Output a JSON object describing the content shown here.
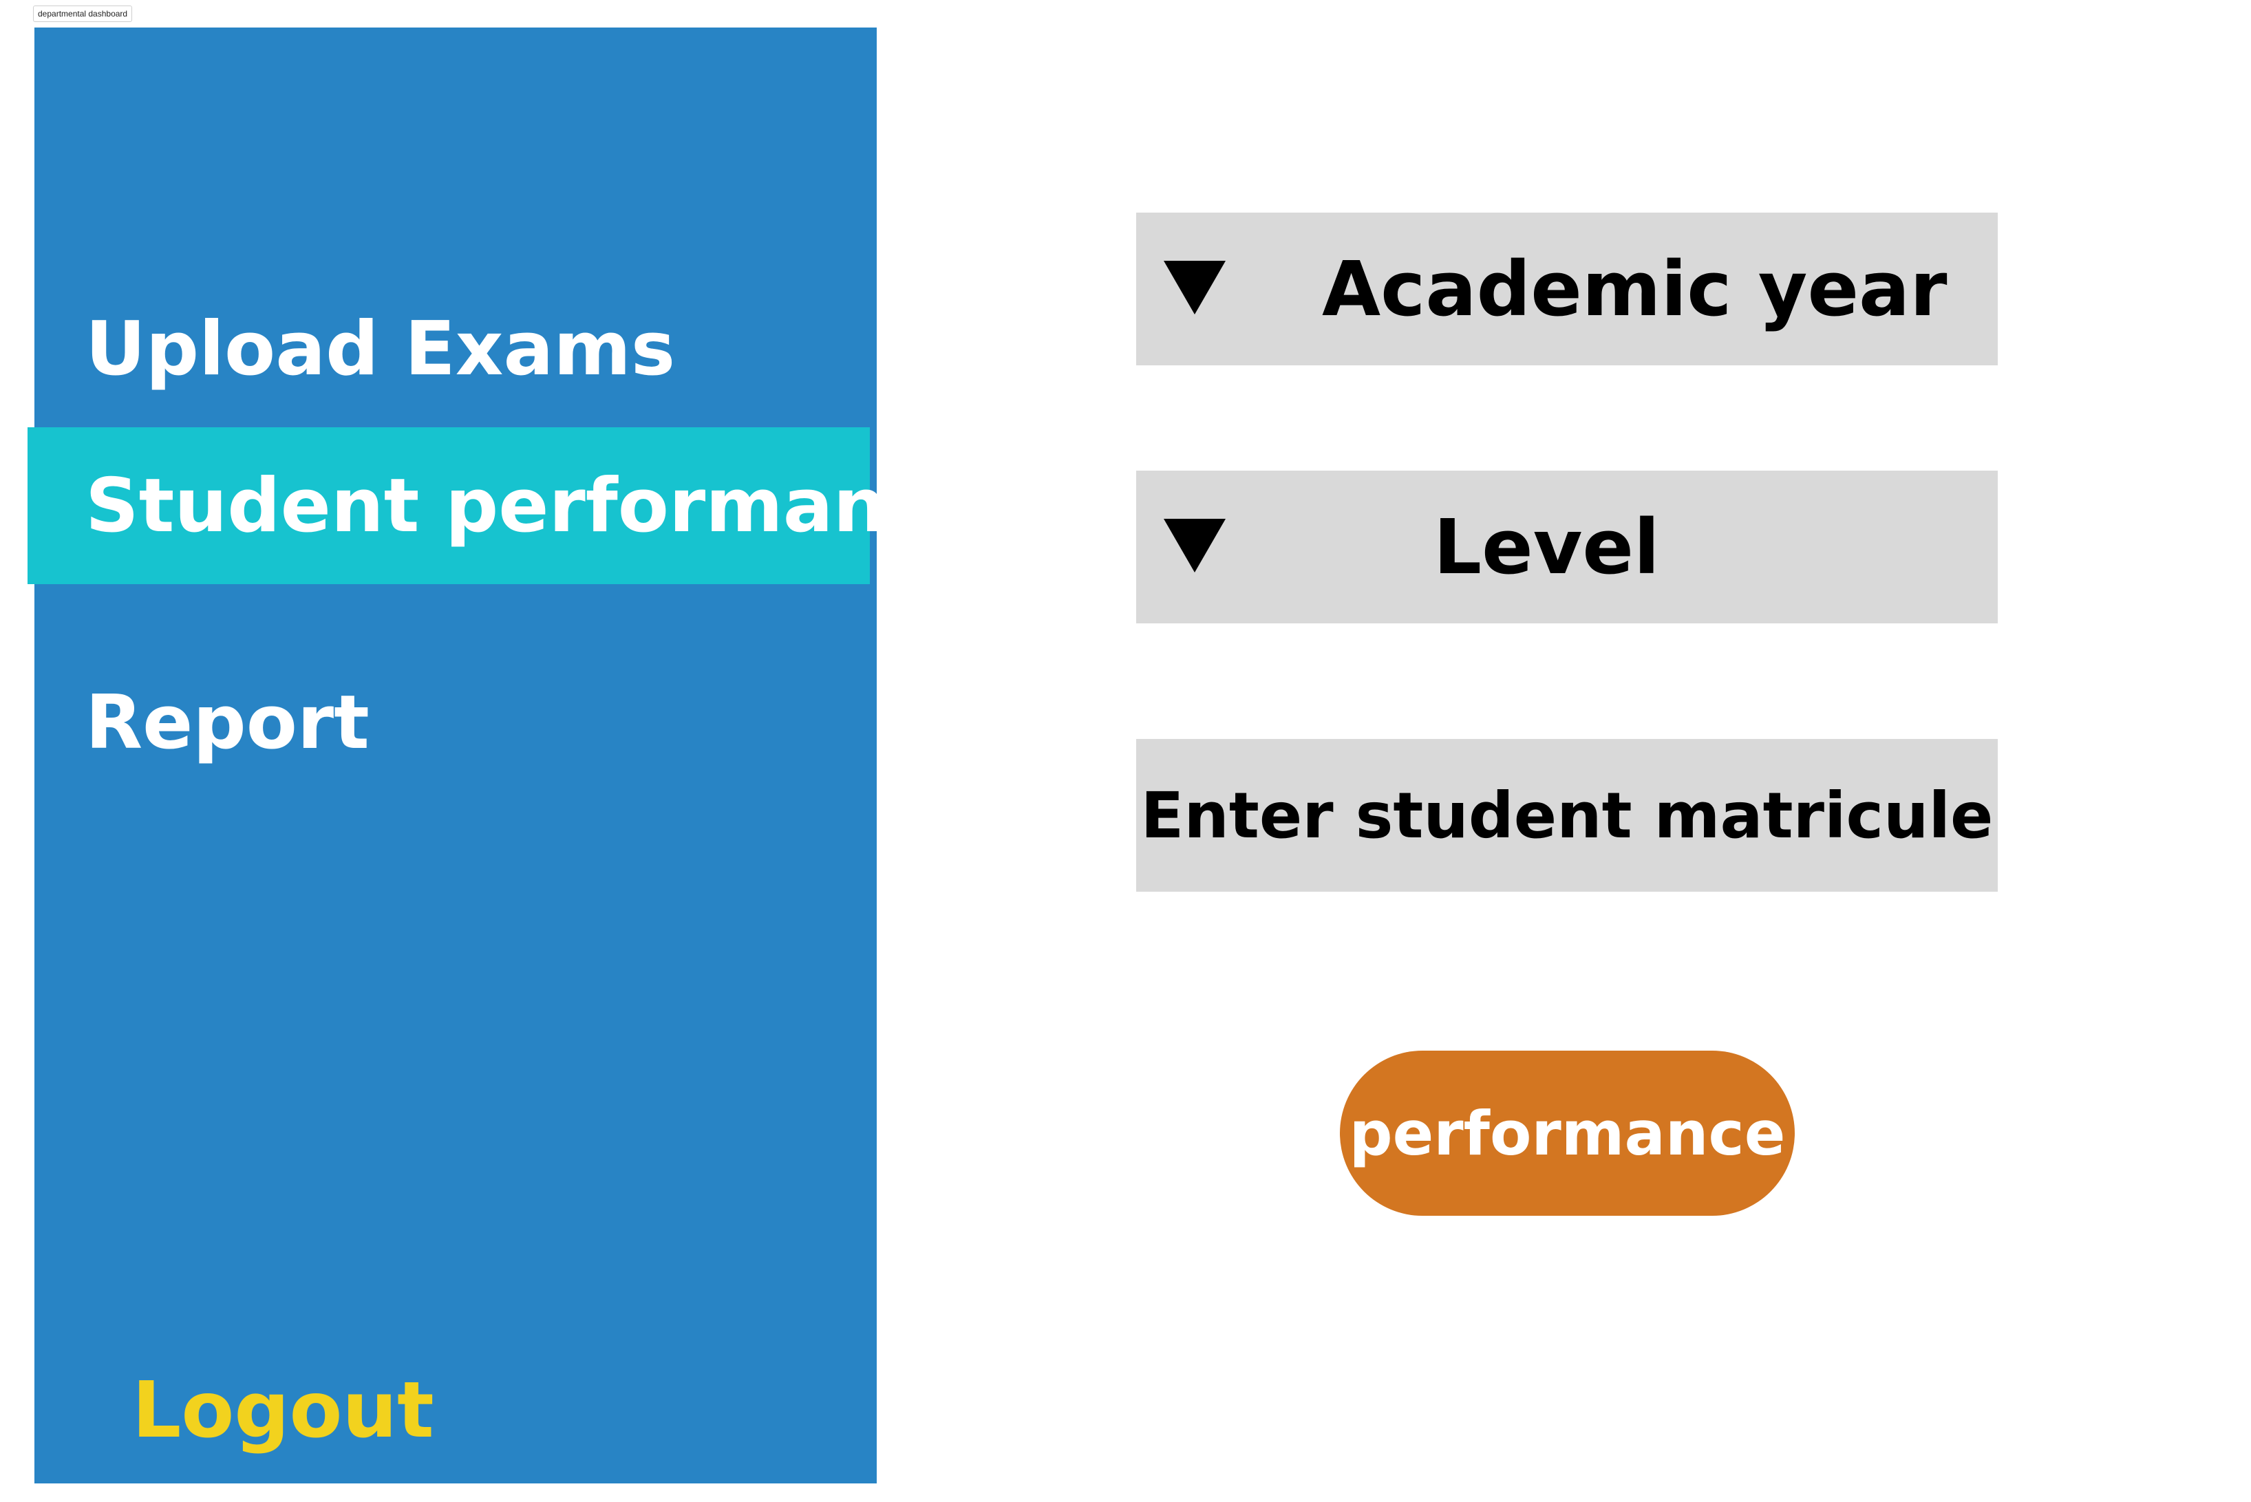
{
  "frame": {
    "label": "departmental dashboard"
  },
  "sidebar": {
    "items": [
      {
        "label": "Upload Exams",
        "active": false
      },
      {
        "label": "Student performance",
        "active": true
      },
      {
        "label": "Report",
        "active": false
      }
    ],
    "logout_label": "Logout",
    "colors": {
      "background": "#2884c5",
      "active_background": "#17c3cf",
      "text": "#ffffff",
      "logout_text": "#f2d21e"
    }
  },
  "filters": {
    "academic_year": {
      "label": "Academic year",
      "icon": "dropdown-triangle-icon"
    },
    "level": {
      "label": "Level",
      "icon": "dropdown-triangle-icon"
    },
    "matricule": {
      "placeholder": "Enter student matricule"
    },
    "colors": {
      "field_background": "#d9d9d9",
      "field_text": "#000000"
    }
  },
  "action": {
    "button_label": "performance",
    "color": "#d37621",
    "text_color": "#ffffff"
  }
}
